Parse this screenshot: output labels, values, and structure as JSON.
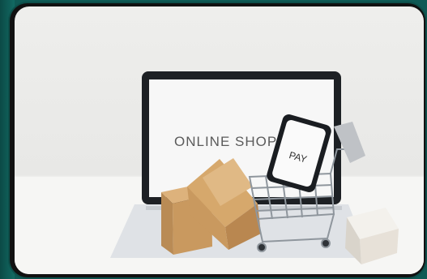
{
  "image": {
    "screen_text": "ONLINE SHOPPING",
    "phone_text": "PAY",
    "colors": {
      "frame": "#0f5a55",
      "backdrop": "#eeeeec",
      "laptop": "#1d2024",
      "box": "#c9995f",
      "cart": "#9aa0a6"
    }
  }
}
